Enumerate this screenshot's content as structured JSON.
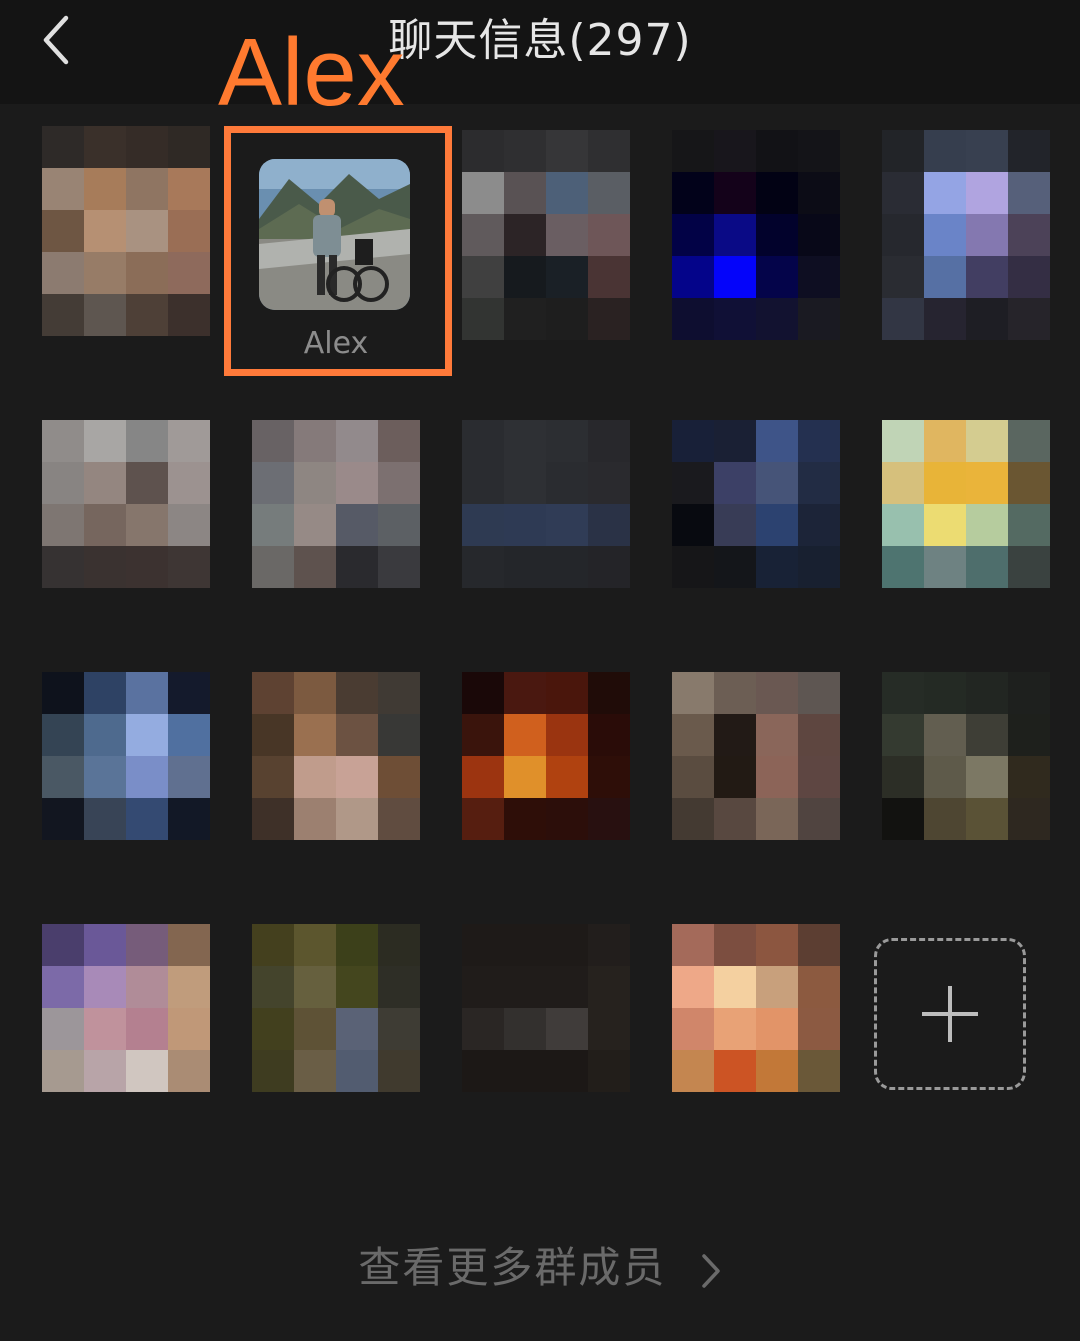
{
  "header": {
    "title": "聊天信息(297)",
    "back_icon": "chevron-left-icon"
  },
  "annotation": {
    "label": "Alex",
    "color": "#ff7a2f"
  },
  "highlighted_member": {
    "name": "Alex"
  },
  "add_member": {
    "icon": "plus-icon"
  },
  "footer": {
    "more_members": "查看更多群成员",
    "icon": "chevron-right-icon"
  },
  "colors": {
    "background": "#1b1b1b",
    "topbar": "#141414",
    "highlight_frame": "#ff7a3a",
    "title_text": "#e6e6e6",
    "muted_text": "#6a6a6a"
  }
}
